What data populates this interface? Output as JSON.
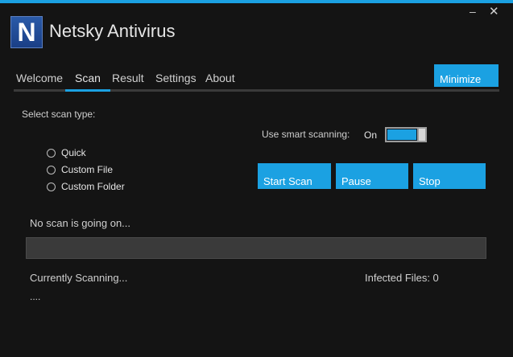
{
  "window": {
    "minimize_glyph": "–",
    "close_glyph": "✕"
  },
  "app": {
    "logo_letter": "N",
    "title": "Netsky Antivirus"
  },
  "tabs": [
    {
      "label": "Welcome",
      "active": false
    },
    {
      "label": "Scan",
      "active": true
    },
    {
      "label": "Result",
      "active": false
    },
    {
      "label": "Settings",
      "active": false
    },
    {
      "label": "About",
      "active": false
    }
  ],
  "minimize_button": {
    "label": "Minimize"
  },
  "scan": {
    "select_type_label": "Select scan type:",
    "options": [
      "Quick",
      "Custom File",
      "Custom Folder"
    ],
    "selected_option": null,
    "smart_label": "Use smart scanning:",
    "smart_state": "On",
    "smart_enabled": true,
    "buttons": {
      "start": "Start Scan",
      "pause": "Pause",
      "stop": "Stop"
    },
    "status_text": "No scan is going on...",
    "progress": 0,
    "currently_scanning_label": "Currently Scanning...",
    "current_file": "....",
    "infected_files_label": "Infected Files: 0"
  },
  "colors": {
    "accent": "#1ba1e2",
    "background": "#141414",
    "progress_track": "#3a3a3a"
  }
}
